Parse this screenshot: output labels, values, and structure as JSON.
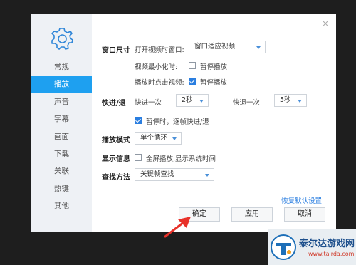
{
  "dialog": {
    "close_glyph": "×"
  },
  "sidebar": {
    "icon": "gear-icon",
    "items": [
      {
        "label": "常规",
        "active": false
      },
      {
        "label": "播放",
        "active": true
      },
      {
        "label": "声音",
        "active": false
      },
      {
        "label": "字幕",
        "active": false
      },
      {
        "label": "画面",
        "active": false
      },
      {
        "label": "下载",
        "active": false
      },
      {
        "label": "关联",
        "active": false
      },
      {
        "label": "热键",
        "active": false
      },
      {
        "label": "其他",
        "active": false
      }
    ]
  },
  "window_size": {
    "label": "窗口尺寸",
    "open_label": "打开视频时窗口:",
    "open_value": "窗口适应视频",
    "minimize_label": "视频最小化时:",
    "minimize_option": "暂停播放",
    "minimize_checked": false,
    "click_label": "播放时点击视频:",
    "click_option": "暂停播放",
    "click_checked": true
  },
  "seek": {
    "label": "快进/退",
    "forward_label": "快进一次",
    "forward_value": "2秒",
    "backward_label": "快退一次",
    "backward_value": "5秒",
    "frame_option": "暂停时，逐帧快进/退",
    "frame_checked": true
  },
  "play_mode": {
    "label": "播放模式",
    "value": "单个循环"
  },
  "display_info": {
    "label": "显示信息",
    "option": "全屏播放,显示系统时间",
    "checked": false
  },
  "search": {
    "label": "查找方法",
    "value": "关键帧查找"
  },
  "restore_link": "恢复默认设置",
  "buttons": {
    "ok": "确定",
    "apply": "应用",
    "cancel": "取消"
  },
  "watermark": {
    "name": "泰尔达游戏网",
    "url": "www.tairda.com"
  },
  "colors": {
    "accent": "#1ea0f0",
    "sidebar_bg": "#eef1f5",
    "arrow": "#e8322a"
  }
}
